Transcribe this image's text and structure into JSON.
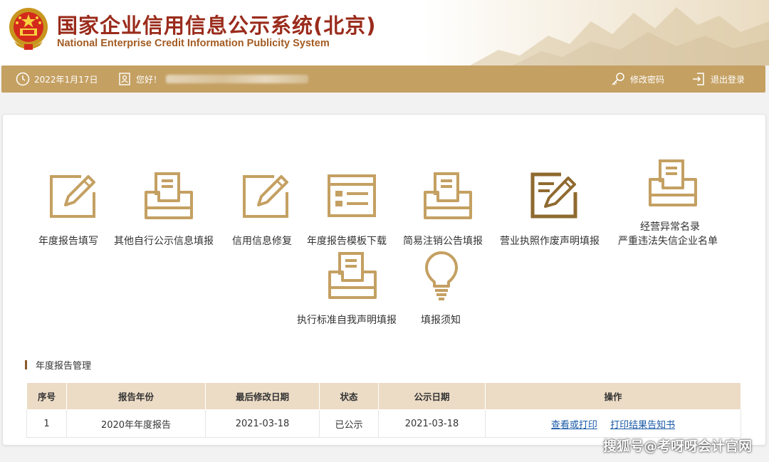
{
  "header": {
    "title_cn": "国家企业信用信息公示系统(北京)",
    "title_en": "National Enterprise Credit Information Publicity System",
    "emblem_icon": "national-emblem-icon"
  },
  "navbar": {
    "date": "2022年1月17日",
    "greeting": "您好！",
    "change_password": "修改密码",
    "logout": "退出登录"
  },
  "tiles": [
    {
      "label": "年度报告填写",
      "icon": "edit-pen-icon"
    },
    {
      "label": "其他自行公示信息填报",
      "icon": "inbox-tray-icon"
    },
    {
      "label": "信用信息修复",
      "icon": "edit-pen-icon"
    },
    {
      "label": "年度报告模板下载",
      "icon": "template-form-icon"
    },
    {
      "label": "简易注销公告填报",
      "icon": "inbox-tray-icon"
    },
    {
      "label": "营业执照作废声明填报",
      "icon": "edit-document-icon"
    },
    {
      "label": "经营异常名录",
      "label2": "严重违法失信企业名单",
      "icon": "inbox-tray-icon"
    },
    {
      "label": "执行标准自我声明填报",
      "icon": "inbox-tray-icon"
    },
    {
      "label": "填报须知",
      "icon": "lightbulb-icon"
    }
  ],
  "section_title": "年度报告管理",
  "table": {
    "headers": [
      "序号",
      "报告年份",
      "最后修改日期",
      "状态",
      "公示日期",
      "操作"
    ],
    "rows": [
      {
        "index": "1",
        "report_year": "2020年年度报告",
        "modified": "2021-03-18",
        "status": "已公示",
        "publish_date": "2021-03-18",
        "action_view": "查看或打印",
        "action_print": "打印结果告知书"
      }
    ]
  },
  "watermark": "搜狐号@考呀呀会计官网",
  "colors": {
    "gold": "#c4a062",
    "title_red": "#9a2b1b",
    "table_header": "#ecdcc6",
    "link": "#1a5aa8"
  }
}
